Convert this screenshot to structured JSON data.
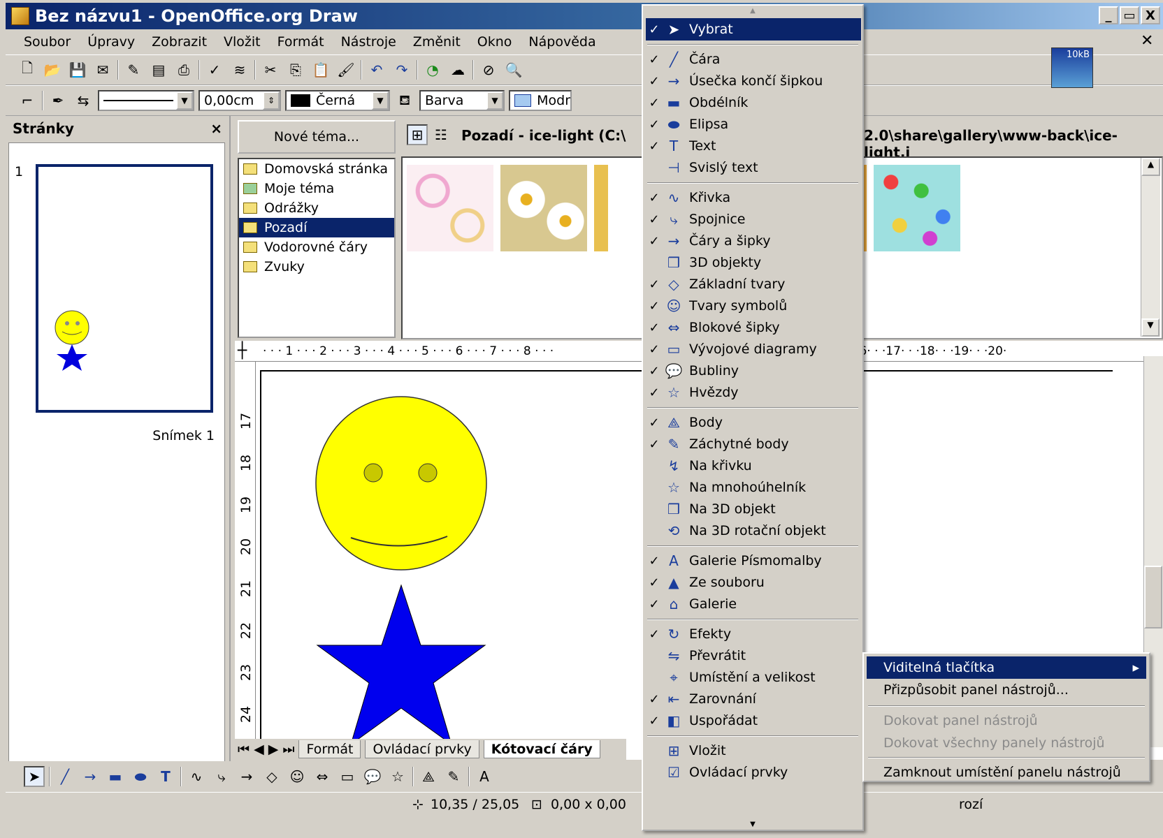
{
  "window": {
    "title": "Bez názvu1 - OpenOffice.org Draw",
    "min": "_",
    "max": "▭",
    "close": "X"
  },
  "menubar": [
    "Soubor",
    "Úpravy",
    "Zobrazit",
    "Vložit",
    "Formát",
    "Nástroje",
    "Změnit",
    "Okno",
    "Nápověda"
  ],
  "toolbar2": {
    "line_width": "0,00cm",
    "color": "Černá",
    "area_style": "Barva",
    "area_color": "Modr"
  },
  "pages": {
    "title": "Stránky",
    "close": "×",
    "page_number": "1",
    "slide_label": "Snímek 1"
  },
  "gallery": {
    "new_theme": "Nové téma...",
    "path_title": "Pozadí - ice-light (C:\\",
    "path_tail": "2.0\\share\\gallery\\www-back\\ice-light.j",
    "themes": [
      "Domovská stránka",
      "Moje téma",
      "Odrážky",
      "Pozadí",
      "Vodorovné čáry",
      "Zvuky"
    ],
    "selected_theme": 3,
    "size_badge": "10kB"
  },
  "ruler": {
    "h": "· · · 1 · · · 2 · · · 3 · · · 4 · · · 5 · · · 6 · · · 7 · · · 8 · · ·",
    "h2": "4· · ·15· · ·16· · ·17· · ·18· · ·19· · ·20·",
    "v": [
      "17",
      "18",
      "19",
      "20",
      "21",
      "22",
      "23",
      "24"
    ]
  },
  "tabs": [
    "Formát",
    "Ovládací prvky",
    "Kótovací čáry"
  ],
  "active_tab": 2,
  "status": {
    "position": "10,35 / 25,05",
    "size": "0,00 x 0,00",
    "tail": "rozí"
  },
  "dropdown": {
    "items": [
      {
        "label": "Vybrat",
        "checked": true,
        "icon": "arrow-cursor-icon",
        "glyph": "➤"
      },
      {
        "label": "Čára",
        "checked": true,
        "icon": "line-icon",
        "glyph": "╱"
      },
      {
        "label": "Úsečka končí šipkou",
        "checked": true,
        "icon": "arrow-line-icon",
        "glyph": "→"
      },
      {
        "label": "Obdélník",
        "checked": true,
        "icon": "rectangle-icon",
        "glyph": "▬"
      },
      {
        "label": "Elipsa",
        "checked": true,
        "icon": "ellipse-icon",
        "glyph": "⬬"
      },
      {
        "label": "Text",
        "checked": true,
        "icon": "text-icon",
        "glyph": "T"
      },
      {
        "label": "Svislý text",
        "checked": false,
        "icon": "vertical-text-icon",
        "glyph": "⊣"
      },
      {
        "label": "Křivka",
        "checked": true,
        "icon": "curve-icon",
        "glyph": "∿"
      },
      {
        "label": "Spojnice",
        "checked": true,
        "icon": "connector-icon",
        "glyph": "⤷"
      },
      {
        "label": "Čáry a šipky",
        "checked": true,
        "icon": "lines-arrows-icon",
        "glyph": "→"
      },
      {
        "label": "3D objekty",
        "checked": false,
        "icon": "cube-icon",
        "glyph": "❒"
      },
      {
        "label": "Základní tvary",
        "checked": true,
        "icon": "diamond-icon",
        "glyph": "◇"
      },
      {
        "label": "Tvary symbolů",
        "checked": true,
        "icon": "smiley-icon",
        "glyph": "☺"
      },
      {
        "label": "Blokové šipky",
        "checked": true,
        "icon": "block-arrow-icon",
        "glyph": "⇔"
      },
      {
        "label": "Vývojové diagramy",
        "checked": true,
        "icon": "flowchart-icon",
        "glyph": "▭"
      },
      {
        "label": "Bubliny",
        "checked": true,
        "icon": "callout-icon",
        "glyph": "💬"
      },
      {
        "label": "Hvězdy",
        "checked": true,
        "icon": "star-icon",
        "glyph": "☆"
      },
      {
        "label": "Body",
        "checked": true,
        "icon": "points-icon",
        "glyph": "⟁"
      },
      {
        "label": "Záchytné body",
        "checked": true,
        "icon": "glue-points-icon",
        "glyph": "✎"
      },
      {
        "label": "Na křivku",
        "checked": false,
        "icon": "to-curve-icon",
        "glyph": "↯"
      },
      {
        "label": "Na mnohoúhelník",
        "checked": false,
        "icon": "to-polygon-icon",
        "glyph": "☆"
      },
      {
        "label": "Na 3D objekt",
        "checked": false,
        "icon": "to-3d-icon",
        "glyph": "❒"
      },
      {
        "label": "Na 3D rotační objekt",
        "checked": false,
        "icon": "to-3d-rotation-icon",
        "glyph": "⟲"
      },
      {
        "label": "Galerie Písmomalby",
        "checked": true,
        "icon": "fontwork-icon",
        "glyph": "A"
      },
      {
        "label": "Ze souboru",
        "checked": true,
        "icon": "from-file-icon",
        "glyph": "▲"
      },
      {
        "label": "Galerie",
        "checked": true,
        "icon": "gallery-icon",
        "glyph": "⌂"
      },
      {
        "label": "Efekty",
        "checked": true,
        "icon": "effects-icon",
        "glyph": "↻"
      },
      {
        "label": "Převrátit",
        "checked": false,
        "icon": "flip-icon",
        "glyph": "⇋"
      },
      {
        "label": "Umístění a velikost",
        "checked": false,
        "icon": "position-size-icon",
        "glyph": "⌖"
      },
      {
        "label": "Zarovnání",
        "checked": true,
        "icon": "align-icon",
        "glyph": "⇤"
      },
      {
        "label": "Uspořádat",
        "checked": true,
        "icon": "arrange-icon",
        "glyph": "◧"
      },
      {
        "label": "Vložit",
        "checked": false,
        "icon": "insert-icon",
        "glyph": "⊞"
      },
      {
        "label": "Ovládací prvky",
        "checked": false,
        "icon": "form-controls-icon",
        "glyph": "☑"
      }
    ]
  },
  "submenu": {
    "items": [
      {
        "label": "Viditelná tlačítka",
        "state": "selected",
        "arrow": "▸"
      },
      {
        "label": "Přizpůsobit panel nástrojů...",
        "state": "normal"
      },
      {
        "label": "Dokovat panel nástrojů",
        "state": "disabled"
      },
      {
        "label": "Dokovat všechny panely nástrojů",
        "state": "disabled"
      },
      {
        "label": "Zamknout umístění panelu nástrojů",
        "state": "normal"
      }
    ]
  }
}
